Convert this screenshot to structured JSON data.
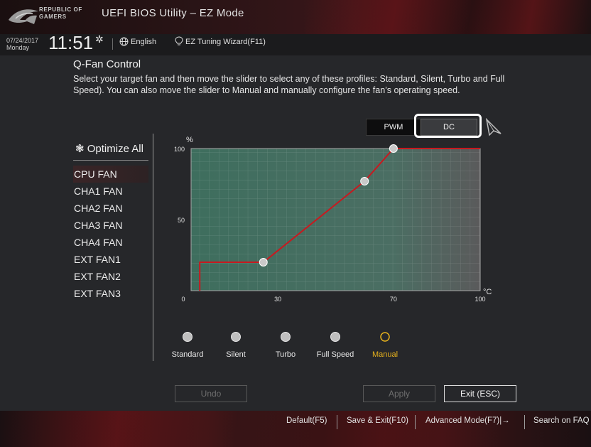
{
  "header": {
    "logo_line1": "REPUBLIC OF",
    "logo_line2": "GAMERS",
    "title": "UEFI BIOS Utility – EZ Mode"
  },
  "infobar": {
    "date": "07/24/2017",
    "day": "Monday",
    "time": "11:51",
    "language": "English",
    "wizard": "EZ Tuning Wizard(F11)"
  },
  "qfan": {
    "title": "Q-Fan Control",
    "description": "Select your target fan and then move the slider to select any of these profiles: Standard, Silent, Turbo and Full Speed). You can also move the slider to Manual and manually configure the fan’s operating speed.",
    "mode_pwm": "PWM",
    "mode_dc": "DC",
    "selected_mode": "DC",
    "optimize_all": "Optimize All",
    "fans": [
      "CPU FAN",
      "CHA1 FAN",
      "CHA2 FAN",
      "CHA3 FAN",
      "CHA4 FAN",
      "EXT FAN1",
      "EXT FAN2",
      "EXT FAN3"
    ],
    "selected_fan": "CPU FAN",
    "profiles": [
      "Standard",
      "Silent",
      "Turbo",
      "Full Speed",
      "Manual"
    ],
    "selected_profile": "Manual"
  },
  "chart_data": {
    "type": "line",
    "ylabel": "%",
    "xlabel": "°C",
    "xlim": [
      0,
      100
    ],
    "ylim": [
      0,
      100
    ],
    "x_ticks": [
      0,
      30,
      70,
      100
    ],
    "y_ticks": [
      100,
      50
    ],
    "grid": true,
    "series": [
      {
        "points": [
          [
            3,
            0
          ],
          [
            3,
            20
          ],
          [
            25,
            20
          ],
          [
            60,
            77
          ],
          [
            70,
            100
          ],
          [
            100,
            100
          ]
        ],
        "handles": [
          [
            25,
            20
          ],
          [
            60,
            77
          ],
          [
            70,
            100
          ]
        ]
      }
    ],
    "line_color": "#c8191f"
  },
  "buttons": {
    "undo": "Undo",
    "apply": "Apply",
    "exit": "Exit (ESC)"
  },
  "bottom_menu": {
    "default": "Default(F5)",
    "save_exit": "Save & Exit(F10)",
    "advanced": "Advanced Mode(F7)|→",
    "search_faq": "Search on FAQ"
  },
  "colors": {
    "accent_profile": "#e7b21d",
    "chart_fill_start": "#3c6b5b",
    "chart_fill_end": "#515252"
  }
}
